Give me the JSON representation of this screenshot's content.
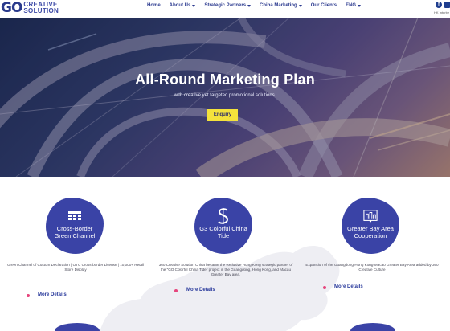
{
  "header": {
    "logo_mark": "GO",
    "logo_line1": "CREATIVE",
    "logo_line2": "SOLUTION",
    "nav": [
      {
        "label": "Home",
        "dropdown": false
      },
      {
        "label": "About Us",
        "dropdown": true
      },
      {
        "label": "Strategic Partners",
        "dropdown": true
      },
      {
        "label": "China Marketing",
        "dropdown": true
      },
      {
        "label": "Our Clients",
        "dropdown": false
      },
      {
        "label": "ENG",
        "dropdown": true
      }
    ],
    "social_label": "HK Interbe"
  },
  "hero": {
    "title": "All-Round Marketing Plan",
    "subtitle": "with creative yet targeted promotional solutions.",
    "button_label": "Enquiry",
    "button_color": "#f4e23c"
  },
  "services": {
    "accent": "#3a43a6",
    "dot_color": "#e6457c",
    "items": [
      {
        "icon": "storefront-grid-icon",
        "title": "Cross-Border Green Channel",
        "desc": "Green Channel of Custom Declaration | OTC Cross-border License | 10,000+ Retail Store Display",
        "more": "More Details"
      },
      {
        "icon": "s-logo-icon",
        "title": "G3 Colorful China Tide",
        "desc": "360 Creative Solution China became the exclusive Hong Kong strategic partner of the \"GO Colorful China Tide\" project in the Guangdong, Hong Kong, and Macau Greater Bay area.",
        "more": "More Details"
      },
      {
        "icon": "city-map-icon",
        "title": "Greater Bay Area Cooperation",
        "desc": "Expansion of the Guangdong-Hong Kong-Macao Greater Bay Area added by 360 Creative Culture",
        "more": "More Details"
      }
    ]
  }
}
